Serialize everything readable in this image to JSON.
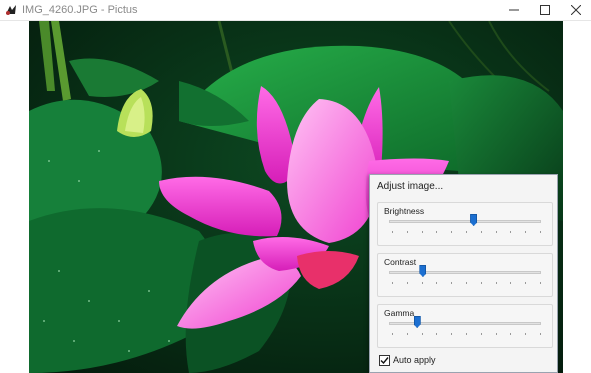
{
  "window": {
    "title": "IMG_4260.JPG - Pictus",
    "app_icon": "pictus-logo-icon",
    "controls": {
      "minimize": "minimize-icon",
      "maximize": "maximize-icon",
      "close": "close-icon"
    }
  },
  "photo": {
    "subject": "pink lotus flower among green lotus leaves"
  },
  "adjust_panel": {
    "title": "Adjust image...",
    "sliders": [
      {
        "label": "Brightness",
        "value": 0.56
      },
      {
        "label": "Contrast",
        "value": 0.21
      },
      {
        "label": "Gamma",
        "value": 0.17
      }
    ],
    "auto_apply": {
      "label": "Auto apply",
      "checked": true
    }
  },
  "colors": {
    "accent": "#1c6fd1",
    "panel_bg": "#f4f4f4",
    "titlebar_text": "#8a8a8a"
  }
}
